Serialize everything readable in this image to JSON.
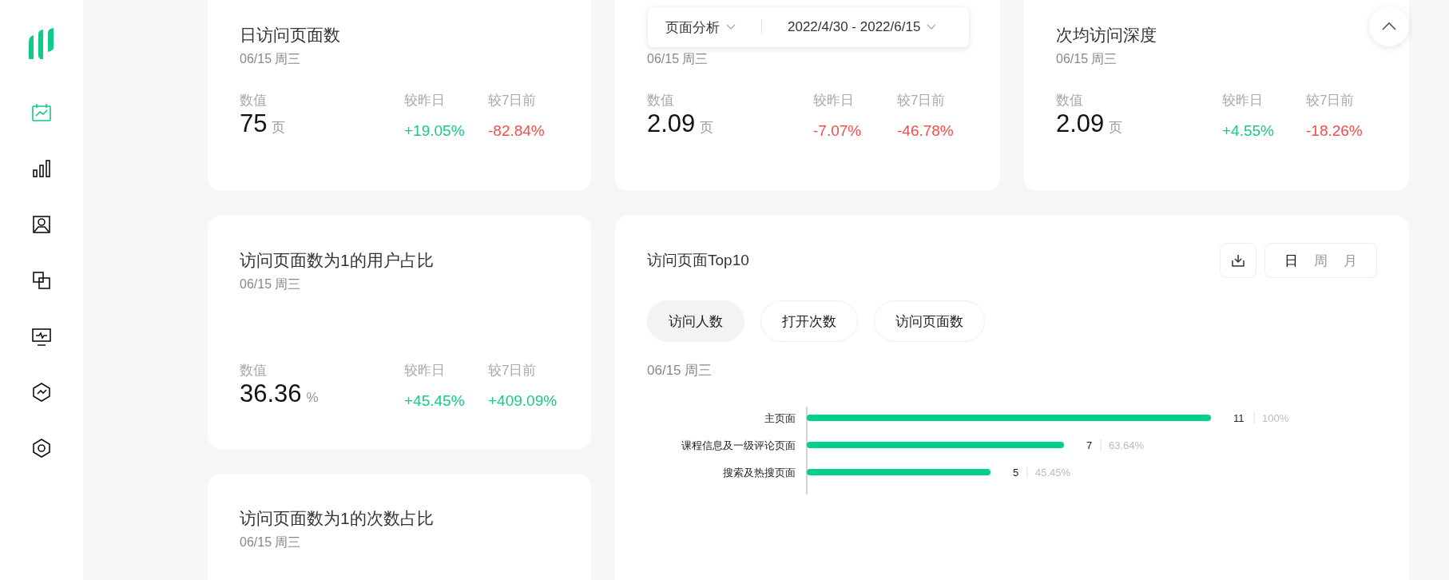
{
  "sidebar": {
    "items": [
      {
        "selected": true
      },
      {
        "selected": false
      },
      {
        "selected": false
      },
      {
        "selected": false
      },
      {
        "selected": false
      },
      {
        "selected": false
      },
      {
        "selected": false
      }
    ]
  },
  "toolbar": {
    "view": "页面分析",
    "date_range": "2022/4/30 - 2022/6/15"
  },
  "cards": [
    {
      "title": "日访问页面数",
      "date": "06/15 周三",
      "value_label": "数值",
      "value": "75",
      "unit": "页",
      "compares": [
        {
          "label": "较昨日",
          "value": "+19.05%",
          "color": "#18c98a"
        },
        {
          "label": "较7日前",
          "value": "-82.84%",
          "color": "#f24d4d"
        }
      ]
    },
    {
      "date": "06/15 周三",
      "value_label": "数值",
      "value": "2.09",
      "unit": "页",
      "compares": [
        {
          "label": "较昨日",
          "value": "-7.07%",
          "color": "#f24d4d"
        },
        {
          "label": "较7日前",
          "value": "-46.78%",
          "color": "#f24d4d"
        }
      ]
    },
    {
      "title": "次均访问深度",
      "date": "06/15 周三",
      "value_label": "数值",
      "value": "2.09",
      "unit": "页",
      "compares": [
        {
          "label": "较昨日",
          "value": "+4.55%",
          "color": "#18c98a"
        },
        {
          "label": "较7日前",
          "value": "-18.26%",
          "color": "#f24d4d"
        }
      ]
    },
    {
      "title": "访问页面数为1的用户占比",
      "date": "06/15 周三",
      "value_label": "数值",
      "value": "36.36",
      "unit": "%",
      "compares": [
        {
          "label": "较昨日",
          "value": "+45.45%",
          "color": "#18c98a"
        },
        {
          "label": "较7日前",
          "value": "+409.09%",
          "color": "#18c98a"
        }
      ]
    },
    {
      "title": "访问页面数为1的次数占比",
      "date": "06/15 周三"
    }
  ],
  "top10": {
    "title": "访问页面Top10",
    "periods": [
      {
        "label": "日",
        "selected": true
      },
      {
        "label": "周",
        "selected": false
      },
      {
        "label": "月",
        "selected": false
      }
    ],
    "tabs": [
      {
        "label": "访问人数",
        "selected": true
      },
      {
        "label": "打开次数",
        "selected": false
      },
      {
        "label": "访问页面数",
        "selected": false
      }
    ],
    "date": "06/15 周三",
    "chart_data": {
      "type": "bar",
      "orientation": "horizontal",
      "categories": [
        "主页面",
        "课程信息及一级评论页面",
        "搜索及热搜页面"
      ],
      "series": [
        {
          "color": "#00d08a",
          "values": [
            11,
            7,
            5
          ]
        }
      ],
      "data_labels": true,
      "annotations": [
        "100%",
        "63.64%",
        "45.45%"
      ]
    }
  }
}
